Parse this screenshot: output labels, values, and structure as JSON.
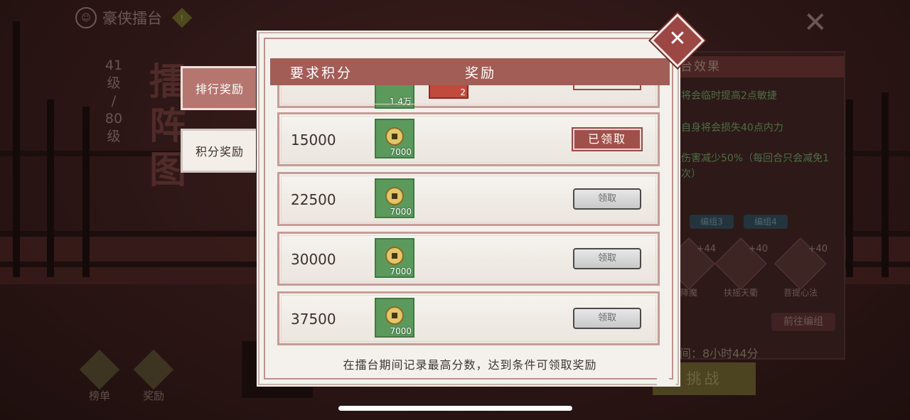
{
  "background": {
    "title": "豪侠擂台",
    "info": "!",
    "level": [
      "41",
      "级",
      "/",
      "80",
      "级"
    ],
    "calligraphy": [
      "擂",
      "阵",
      "图"
    ],
    "close_glyph": "✕",
    "panel": {
      "header": "台效果",
      "effects": [
        "将会临时提高2点敏捷",
        "自身将会损失40点内力",
        "伤害减少50%（每回合只会减免1次）"
      ],
      "chips": [
        "编组3",
        "编组4"
      ],
      "skills": [
        {
          "name": "降魔",
          "level": "+44"
        },
        {
          "name": "扶摇天衢",
          "level": "+40"
        },
        {
          "name": "菩提心法",
          "level": "+40"
        }
      ],
      "goto_group": "前往编组",
      "timer": "间：8小时44分",
      "fight": "挑战"
    },
    "bottom_buttons": [
      "榜单",
      "奖励"
    ]
  },
  "tabs": {
    "rank_rewards": "排行奖励",
    "score_rewards": "积分奖励"
  },
  "modal": {
    "header_required": "要求积分",
    "header_reward": "奖励",
    "close_glyph": "✕",
    "partial_row": {
      "qty_a": "1.4万",
      "qty_b": "2"
    },
    "rows": [
      {
        "score": "15000",
        "qty": "7000",
        "status": "已领取"
      },
      {
        "score": "22500",
        "qty": "7000",
        "status": "领取"
      },
      {
        "score": "30000",
        "qty": "7000",
        "status": "领取"
      },
      {
        "score": "37500",
        "qty": "7000",
        "status": "领取"
      }
    ],
    "footer": "在擂台期间记录最高分数，达到条件可领取奖励"
  }
}
